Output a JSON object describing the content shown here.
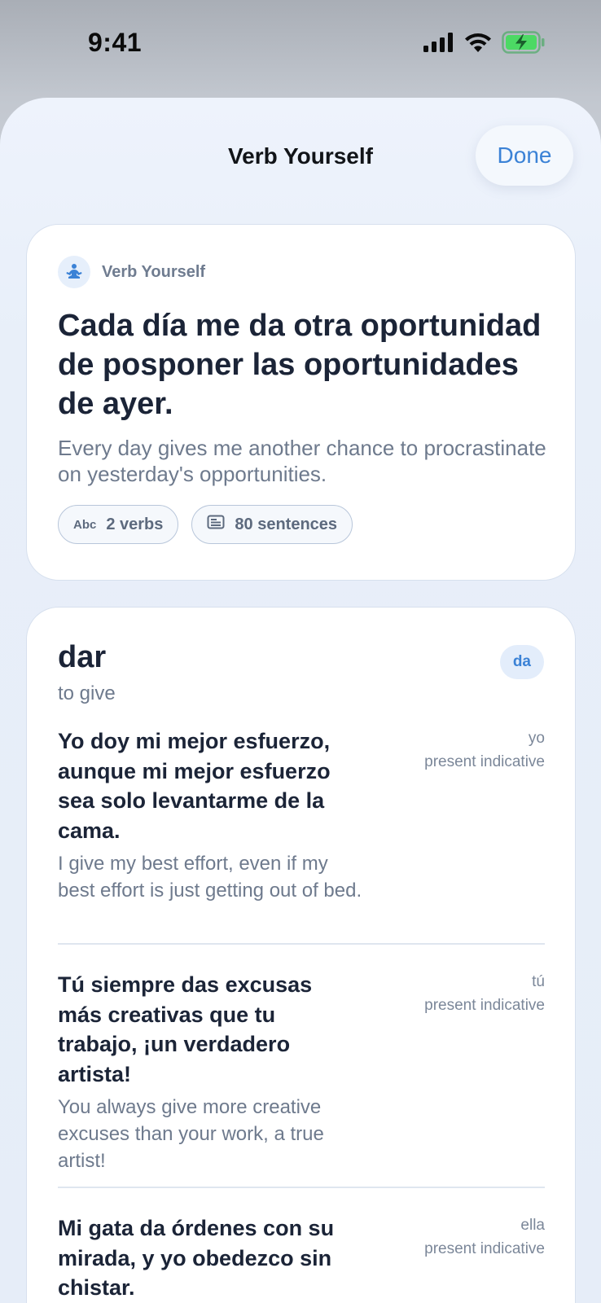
{
  "status_bar": {
    "time": "9:41"
  },
  "sheet": {
    "title": "Verb Yourself",
    "done_label": "Done"
  },
  "hero": {
    "brand": "Verb Yourself",
    "spanish": "Cada día me da otra oportunidad de posponer las oportunidades de ayer.",
    "english": "Every day gives me another chance to procrastinate on yesterday's opportunities.",
    "verbs_pill_icon_text": "Abc",
    "verbs_pill": "2 verbs",
    "sentences_pill": "80 sentences"
  },
  "verb": {
    "name": "dar",
    "meaning": "to give",
    "form_badge": "da",
    "examples": [
      {
        "spanish": "Yo doy mi mejor esfuerzo, aunque mi mejor esfuerzo sea solo levantarme de la cama.",
        "english": "I give my best effort, even if my best effort is just getting out of bed.",
        "pronoun": "yo",
        "tense": "present indicative"
      },
      {
        "spanish": "Tú siempre das excusas más creativas que tu trabajo, ¡un verdadero artista!",
        "english": "You always give more creative excuses than your work, a true artist!",
        "pronoun": "tú",
        "tense": "present indicative"
      },
      {
        "spanish": "Mi gata da órdenes con su mirada, y yo obedezco sin chistar.",
        "english": "",
        "pronoun": "ella",
        "tense": "present indicative"
      }
    ]
  },
  "colors": {
    "accent": "#3b82d6",
    "title_text": "#1b2437",
    "secondary_text": "#6e7a8d",
    "battery_charging": "#4cd964"
  },
  "icons": {
    "signal": "cellular-signal-icon",
    "wifi": "wifi-icon",
    "battery": "battery-charging-icon",
    "brand": "meditation-person-icon",
    "sentences": "document-lines-icon"
  }
}
